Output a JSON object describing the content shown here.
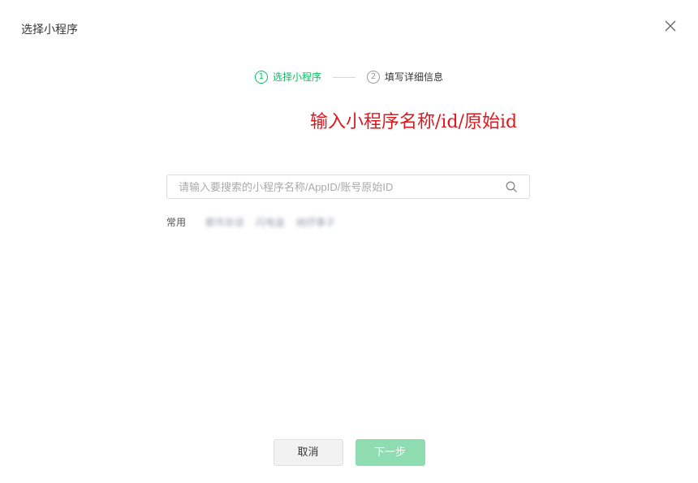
{
  "dialog": {
    "title": "选择小程序"
  },
  "steps": [
    {
      "number": "1",
      "label": "选择小程序",
      "active": true
    },
    {
      "number": "2",
      "label": "填写详细信息",
      "active": false
    }
  ],
  "annotation": "输入小程序名称/id/原始id",
  "search": {
    "placeholder": "请输入要搜索的小程序名称/AppID/账号原始ID",
    "value": ""
  },
  "frequent": {
    "label": "常用",
    "items": [
      "都市杂谈",
      "闪电盒",
      "她抒事子"
    ]
  },
  "footer": {
    "cancel_label": "取消",
    "next_label": "下一步"
  },
  "colors": {
    "accent": "#07c160",
    "next_button_disabled": "#8fdcb0",
    "annotation": "#e0161f"
  }
}
